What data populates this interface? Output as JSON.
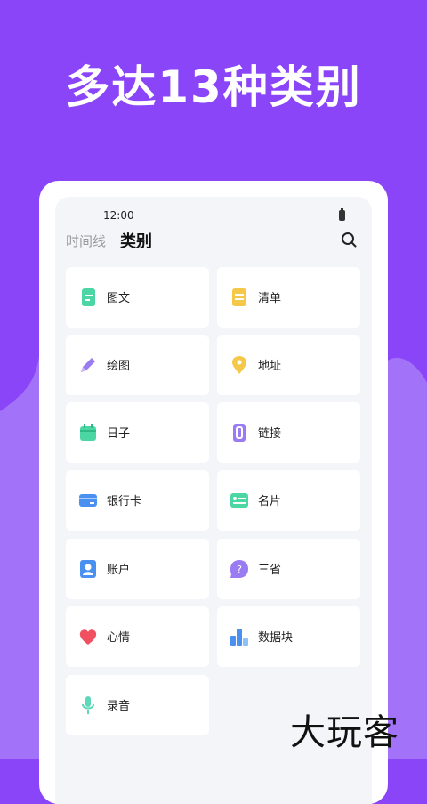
{
  "headline": "多达13种类别",
  "status": {
    "time": "12:00"
  },
  "tabs": {
    "timeline": "时间线",
    "category": "类别"
  },
  "categories": [
    {
      "label": "图文",
      "icon": "document-icon",
      "color": "#4cd6a4"
    },
    {
      "label": "清单",
      "icon": "checklist-icon",
      "color": "#f5c84a"
    },
    {
      "label": "绘图",
      "icon": "pencil-icon",
      "color": "#9a7cf2"
    },
    {
      "label": "地址",
      "icon": "location-pin-icon",
      "color": "#f5c84a"
    },
    {
      "label": "日子",
      "icon": "calendar-icon",
      "color": "#4cd6a4"
    },
    {
      "label": "链接",
      "icon": "link-icon",
      "color": "#9a7cf2"
    },
    {
      "label": "银行卡",
      "icon": "bank-card-icon",
      "color": "#4a90f0"
    },
    {
      "label": "名片",
      "icon": "business-card-icon",
      "color": "#4cd6a4"
    },
    {
      "label": "账户",
      "icon": "account-icon",
      "color": "#4a90f0"
    },
    {
      "label": "三省",
      "icon": "question-bubble-icon",
      "color": "#9a7cf2"
    },
    {
      "label": "心情",
      "icon": "heart-icon",
      "color": "#f05060"
    },
    {
      "label": "数据块",
      "icon": "data-block-icon",
      "color": "#4a90f0"
    },
    {
      "label": "录音",
      "icon": "microphone-icon",
      "color": "#5ed8b8"
    }
  ],
  "watermark": "大玩客"
}
